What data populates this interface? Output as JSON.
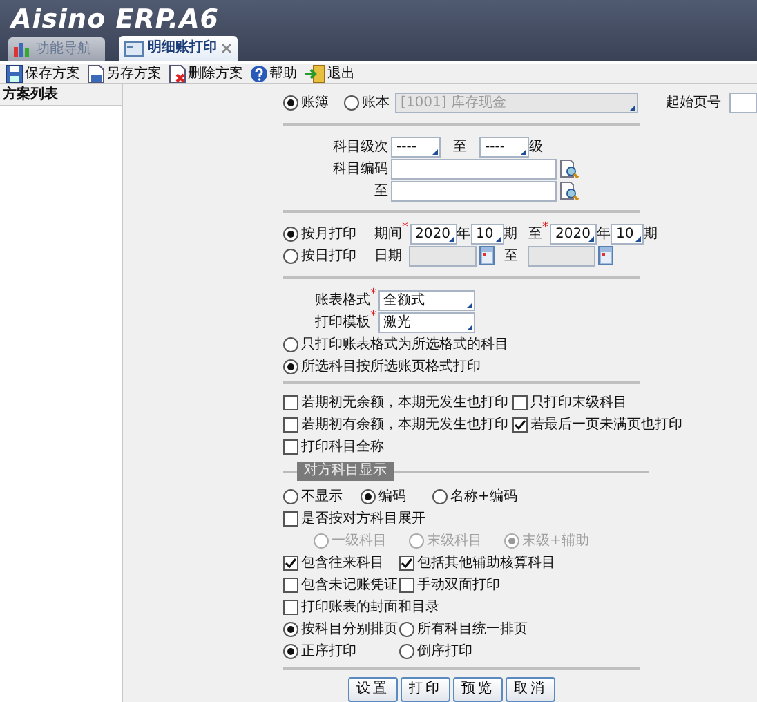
{
  "header": {
    "logo": "Aisino ERP.A6"
  },
  "tabs": [
    {
      "label": "功能导航",
      "selected": false,
      "closable": false
    },
    {
      "label": "明细账打印",
      "selected": true,
      "closable": true
    }
  ],
  "toolbar": [
    {
      "label": "保存方案",
      "kind": "save"
    },
    {
      "label": "另存方案",
      "kind": "saveas"
    },
    {
      "label": "删除方案",
      "kind": "delete"
    },
    {
      "label": "帮助",
      "kind": "help"
    },
    {
      "label": "退出",
      "kind": "exit"
    }
  ],
  "sidebar": {
    "title": "方案列表"
  },
  "form": {
    "book": {
      "options": [
        {
          "label": "账簿",
          "selected": true
        },
        {
          "label": "账本",
          "selected": false
        }
      ],
      "account": "[1001] 库存现金",
      "start_page_label": "起始页号"
    },
    "level": {
      "label": "科目级次",
      "from": "----",
      "to_label": "至",
      "to": "----",
      "suffix": "级"
    },
    "code": {
      "label": "科目编码",
      "to_label": "至"
    },
    "monthly": {
      "label": "按月打印",
      "selected": true,
      "period_label": "期间",
      "required_mark": "*",
      "from_year": "2020",
      "year_unit": "年",
      "from_period": "10",
      "period_unit": "期",
      "to_label": "至",
      "to_required_mark": "*",
      "to_year": "2020",
      "to_year_unit": "年",
      "to_period": "10",
      "to_period_unit": "期"
    },
    "daily": {
      "label": "按日打印",
      "selected": false,
      "date_label": "日期",
      "to_label": "至"
    },
    "format": [
      {
        "label": "账表格式",
        "required_mark": "*",
        "value": "全额式"
      },
      {
        "label": "打印模板",
        "required_mark": "*",
        "value": "激光"
      }
    ],
    "scope": [
      {
        "label": "只打印账表格式为所选格式的科目",
        "selected": false
      },
      {
        "label": "所选科目按所选账页格式打印",
        "selected": true
      }
    ],
    "print_options": [
      [
        {
          "label": "若期初无余额，本期无发生也打印",
          "checked": false
        },
        {
          "label": "只打印末级科目",
          "checked": false
        }
      ],
      [
        {
          "label": "若期初有余额，本期无发生也打印",
          "checked": false
        },
        {
          "label": "若最后一页未满页也打印",
          "checked": true
        }
      ],
      [
        {
          "label": "打印科目全称",
          "checked": false
        }
      ]
    ],
    "counter": {
      "title": "对方科目显示",
      "modes": [
        {
          "label": "不显示",
          "selected": false
        },
        {
          "label": "编码",
          "selected": true
        },
        {
          "label": "名称+编码",
          "selected": false
        }
      ],
      "expand": {
        "label": "是否按对方科目展开",
        "checked": false
      },
      "levels": [
        {
          "label": "一级科目",
          "selected": false,
          "disabled": true
        },
        {
          "label": "末级科目",
          "selected": false,
          "disabled": true
        },
        {
          "label": "末级+辅助",
          "selected": true,
          "disabled": true
        }
      ]
    },
    "extra_options": [
      [
        {
          "kind": "check",
          "label": "包含往来科目",
          "checked": true
        },
        {
          "kind": "check",
          "label": "包括其他辅助核算科目",
          "checked": true
        }
      ],
      [
        {
          "kind": "check",
          "label": "包含未记账凭证",
          "checked": false
        },
        {
          "kind": "check",
          "label": "手动双面打印",
          "checked": false
        }
      ],
      [
        {
          "kind": "check",
          "label": "打印账表的封面和目录",
          "checked": false
        }
      ],
      [
        {
          "kind": "radio",
          "label": "按科目分别排页",
          "selected": true
        },
        {
          "kind": "radio",
          "label": "所有科目统一排页",
          "selected": false
        }
      ],
      [
        {
          "kind": "radio",
          "label": "正序打印",
          "selected": true
        },
        {
          "kind": "radio",
          "label": "倒序打印",
          "selected": false
        }
      ]
    ],
    "buttons": [
      "设置",
      "打印",
      "预览",
      "取消"
    ]
  }
}
